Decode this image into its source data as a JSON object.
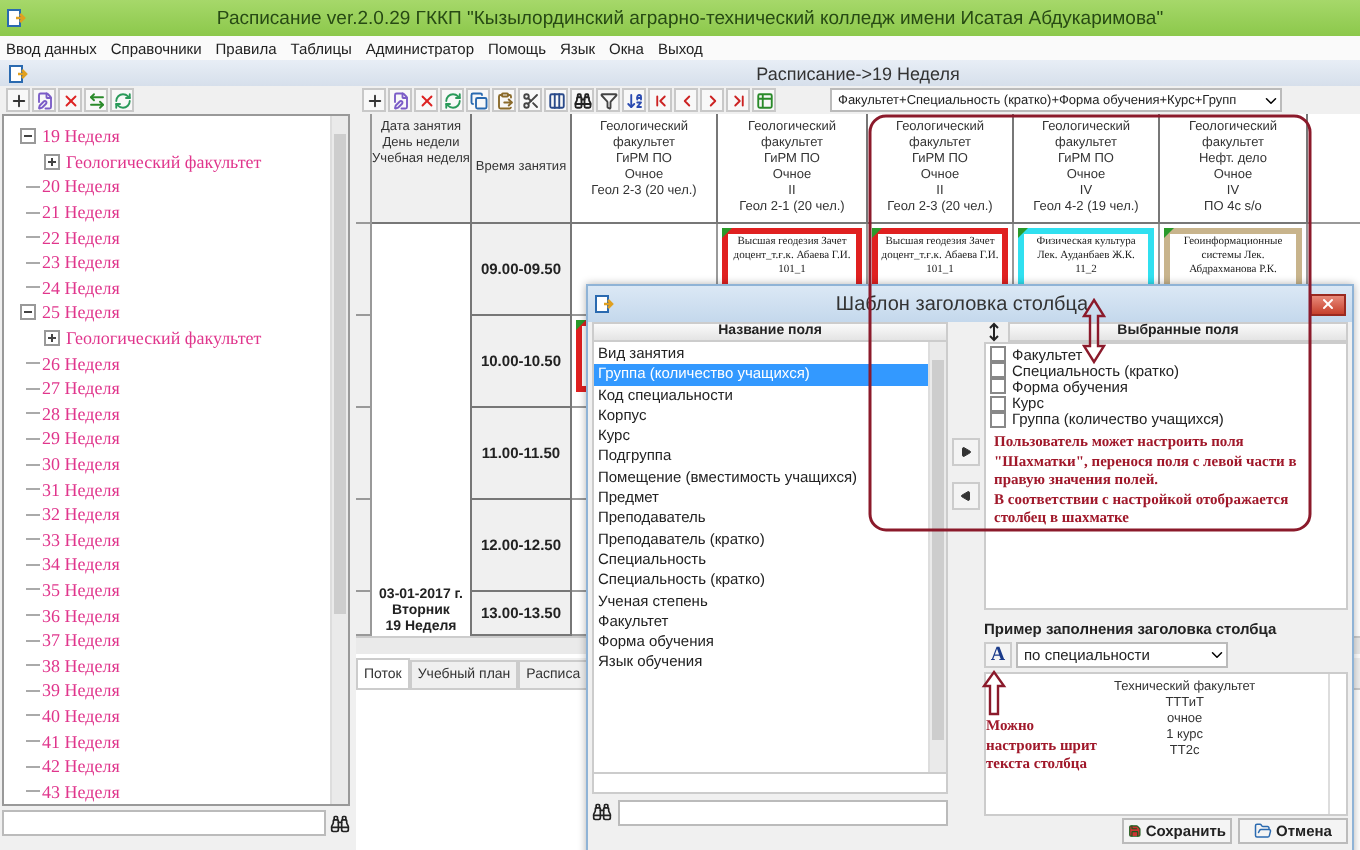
{
  "window": {
    "title": "Расписание ver.2.0.29 ГККП \"Кызылординский аграрно-технический колледж имени Исатая Абдукаримова\""
  },
  "menu": [
    "Ввод данных",
    "Справочники",
    "Правила",
    "Таблицы",
    "Администратор",
    "Помощь",
    "Язык",
    "Окна",
    "Выход"
  ],
  "tree": [
    {
      "label": "19 Неделя",
      "expanded": true,
      "children": [
        {
          "label": "Геологический факультет",
          "expanded": false
        }
      ]
    },
    {
      "label": "20 Неделя"
    },
    {
      "label": "21 Неделя"
    },
    {
      "label": "22 Неделя"
    },
    {
      "label": "23 Неделя"
    },
    {
      "label": "24 Неделя"
    },
    {
      "label": "25 Неделя",
      "expanded": true,
      "children": [
        {
          "label": "Геологический факультет",
          "expanded": false
        }
      ]
    },
    {
      "label": "26 Неделя"
    },
    {
      "label": "27 Неделя"
    },
    {
      "label": "28 Неделя"
    },
    {
      "label": "29 Неделя"
    },
    {
      "label": "30 Неделя"
    },
    {
      "label": "31 Неделя"
    },
    {
      "label": "32 Неделя"
    },
    {
      "label": "33 Неделя"
    },
    {
      "label": "34 Неделя"
    },
    {
      "label": "35 Неделя"
    },
    {
      "label": "36 Неделя"
    },
    {
      "label": "37 Неделя"
    },
    {
      "label": "38 Неделя"
    },
    {
      "label": "39 Неделя"
    },
    {
      "label": "40 Неделя"
    },
    {
      "label": "41 Неделя"
    },
    {
      "label": "42 Неделя"
    },
    {
      "label": "43 Неделя"
    }
  ],
  "schedule": {
    "title": "Расписание->19 Неделя",
    "view_combo": "Факультет+Специальность (кратко)+Форма обучения+Курс+Групп",
    "date_header": "Дата занятия\nДень недели\nУчебная неделя",
    "time_header": "Время занятия",
    "columns": [
      "Геологический\nфакультет\nГиРМ ПО\nОчное\nГеол 2-3 (20 чел.)",
      "Геологический\nфакультет\nГиРМ ПО\nОчное\nII\nГеол 2-1 (20 чел.)",
      "Геологический\nфакультет\nГиРМ ПО\nОчное\nII\nГеол 2-3 (20 чел.)",
      "Геологический\nфакультет\nГиРМ ПО\nОчное\nIV\nГеол 4-2 (19 чел.)",
      "Геологический\nфакультет\nНефт. дело\nОчное\nIV\nПО 4с s/o"
    ],
    "rows": [
      {
        "time": "09.00-09.50",
        "cells": [
          null,
          {
            "text": "Высшая геодезия Зачет доцент_т.ғ.к. Абаева Г.И. 101_1",
            "color": "#e02020"
          },
          {
            "text": "Высшая геодезия Зачет доцент_т.ғ.к. Абаева Г.И. 101_1",
            "color": "#e02020"
          },
          {
            "text": "Физическая культура Лек. Ауданбаев Ж.К. 11_2",
            "color": "#30e0f0"
          },
          {
            "text": "Геоинформационные системы Лек. Абдрахманова Р.К.",
            "color": "#c8b48c"
          }
        ]
      },
      {
        "time": "10.00-10.50",
        "cells": [
          {
            "color": "#e02020"
          },
          null,
          null,
          null,
          null
        ]
      },
      {
        "time": "11.00-11.50",
        "cells": [
          null,
          null,
          null,
          null,
          null
        ]
      },
      {
        "time": "12.00-12.50",
        "cells": [
          null,
          null,
          null,
          null,
          null
        ]
      },
      {
        "time": "13.00-13.50",
        "cells": [
          null,
          null,
          null,
          null,
          null
        ]
      }
    ],
    "date_cell": "03-01-2017 г.\nВторник\n19 Неделя"
  },
  "tabs": [
    {
      "label": "Поток",
      "selected": true
    },
    {
      "label": "Учебный план",
      "selected": false
    },
    {
      "label": "Расписа",
      "selected": false
    }
  ],
  "dialog": {
    "title": "Шаблон заголовка столбца",
    "fields_header": "Название поля",
    "fields": [
      {
        "label": "Вид занятия",
        "selected": false
      },
      {
        "label": "Группа (количество учащихся)",
        "selected": true
      },
      {
        "label": "Код специальности",
        "selected": false
      },
      {
        "label": "Корпус",
        "selected": false
      },
      {
        "label": "Курс",
        "selected": false
      },
      {
        "label": "Подгруппа",
        "selected": false
      },
      {
        "label": "Помещение (вместимость учащихся)",
        "selected": false
      },
      {
        "label": "Предмет",
        "selected": false
      },
      {
        "label": "Преподаватель",
        "selected": false
      },
      {
        "label": "Преподаватель (кратко)",
        "selected": false
      },
      {
        "label": "Специальность",
        "selected": false
      },
      {
        "label": "Специальность (кратко)",
        "selected": false
      },
      {
        "label": "Ученая степень",
        "selected": false
      },
      {
        "label": "Факультет",
        "selected": false
      },
      {
        "label": "Форма обучения",
        "selected": false
      },
      {
        "label": "Язык обучения",
        "selected": false
      }
    ],
    "selected_header": "Выбранные поля",
    "selected_fields": [
      {
        "label": "Факультет",
        "checked": false
      },
      {
        "label": "Специальность (кратко)",
        "checked": false
      },
      {
        "label": "Форма обучения",
        "checked": false
      },
      {
        "label": "Курс",
        "checked": false
      },
      {
        "label": "Группа (количество учащихся)",
        "checked": false
      }
    ],
    "example_label": "Пример заполнения заголовка столбца",
    "font_button": "A",
    "example_combo": "по специальности",
    "preview": "Технический факультет\nТТТиТ\nочное\n1 курс\nТТ2с",
    "buttons": [
      {
        "label": "Сохранить",
        "kind": "save"
      },
      {
        "label": "Отмена",
        "kind": "cancel"
      }
    ]
  },
  "annotations": {
    "fields_note": "Пользователь может настроить поля \"Шахматки\", перенося поля с левой части в правую значения полей.\nВ соответствии с настройкой отображается столбец в шахматке",
    "font_note": "Можно настроить шрит текста столбца"
  }
}
